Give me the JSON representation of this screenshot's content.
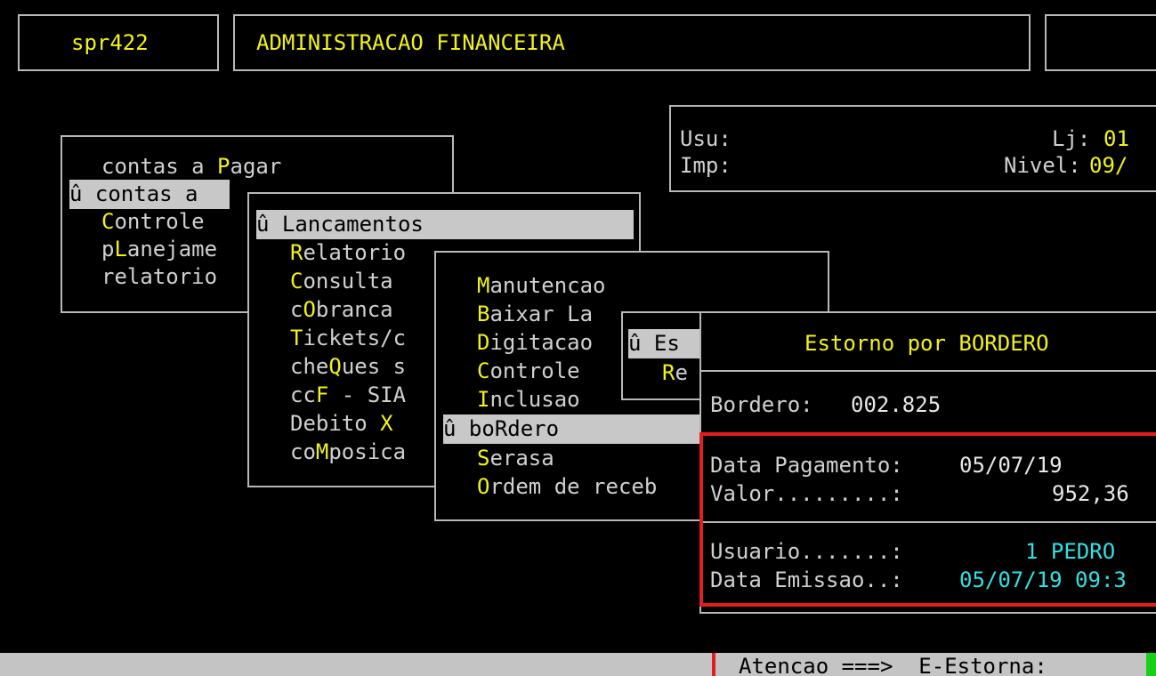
{
  "header": {
    "program_id": "spr422",
    "system_title": "ADMINISTRACAO FINANCEIRA"
  },
  "user_panel": {
    "usu_label": "Usu:",
    "imp_label": "Imp:",
    "lj_label": "Lj:",
    "lj_value": "01",
    "nivel_label": "Nivel:",
    "nivel_value": "09/"
  },
  "marker": "û",
  "menu1": {
    "items": [
      {
        "pre": "contas a ",
        "hot": "P",
        "post": "agar"
      },
      {
        "pre": "contas a ",
        "hot": "",
        "post": ""
      },
      {
        "pre": "",
        "hot": "C",
        "post": "ontrole"
      },
      {
        "pre": "p",
        "hot": "L",
        "post": "anejame"
      },
      {
        "pre": "relatorio",
        "hot": "",
        "post": ""
      }
    ]
  },
  "menu2": {
    "items": [
      {
        "pre": "",
        "hot": "L",
        "post": "ancamentos"
      },
      {
        "pre": "",
        "hot": "R",
        "post": "elatorio"
      },
      {
        "pre": "",
        "hot": "C",
        "post": "onsulta"
      },
      {
        "pre": "c",
        "hot": "O",
        "post": "branca"
      },
      {
        "pre": "",
        "hot": "T",
        "post": "ickets/c"
      },
      {
        "pre": "che",
        "hot": "Q",
        "post": "ues s"
      },
      {
        "pre": "cc",
        "hot": "F",
        "post": " - SIA"
      },
      {
        "pre": "Debito ",
        "hot": "X",
        "post": ""
      },
      {
        "pre": "co",
        "hot": "M",
        "post": "posica"
      }
    ]
  },
  "menu3": {
    "items": [
      {
        "pre": "",
        "hot": "M",
        "post": "anutencao"
      },
      {
        "pre": "",
        "hot": "B",
        "post": "aixar La"
      },
      {
        "pre": "",
        "hot": "D",
        "post": "igitacao"
      },
      {
        "pre": "",
        "hot": "C",
        "post": "ontrole"
      },
      {
        "pre": "",
        "hot": "I",
        "post": "nclusao"
      },
      {
        "pre": "bo",
        "hot": "R",
        "post": "dero"
      },
      {
        "pre": "",
        "hot": "S",
        "post": "erasa"
      },
      {
        "pre": "",
        "hot": "O",
        "post": "rdem de receb"
      }
    ]
  },
  "menu4": {
    "items": [
      {
        "pre": "",
        "hot": "E",
        "post": "s"
      },
      {
        "pre": "",
        "hot": "R",
        "post": "e"
      }
    ]
  },
  "dialog": {
    "title": "Estorno por BORDERO",
    "bordero_label": "Bordero:",
    "bordero_value": "002.825",
    "data_pagamento_label": "Data Pagamento:",
    "data_pagamento_value": "05/07/19",
    "valor_label": "Valor.........:",
    "valor_value": "952,36",
    "usuario_label": "Usuario.......:",
    "usuario_value": "1 PEDRO",
    "data_emissao_label": "Data Emissao..:",
    "data_emissao_value": "05/07/19 09:3"
  },
  "status_bar": {
    "text": "Atencao ===>  E-Estorna:"
  },
  "colors": {
    "background": "#000000",
    "border": "#b8b8b8",
    "highlight_text": "#f2f21a",
    "cyan_text": "#33e0e0",
    "selection_bg": "#c8c8c8",
    "annotation_red": "#e41e1e",
    "status_bar_bg": "#c4c4c4"
  }
}
